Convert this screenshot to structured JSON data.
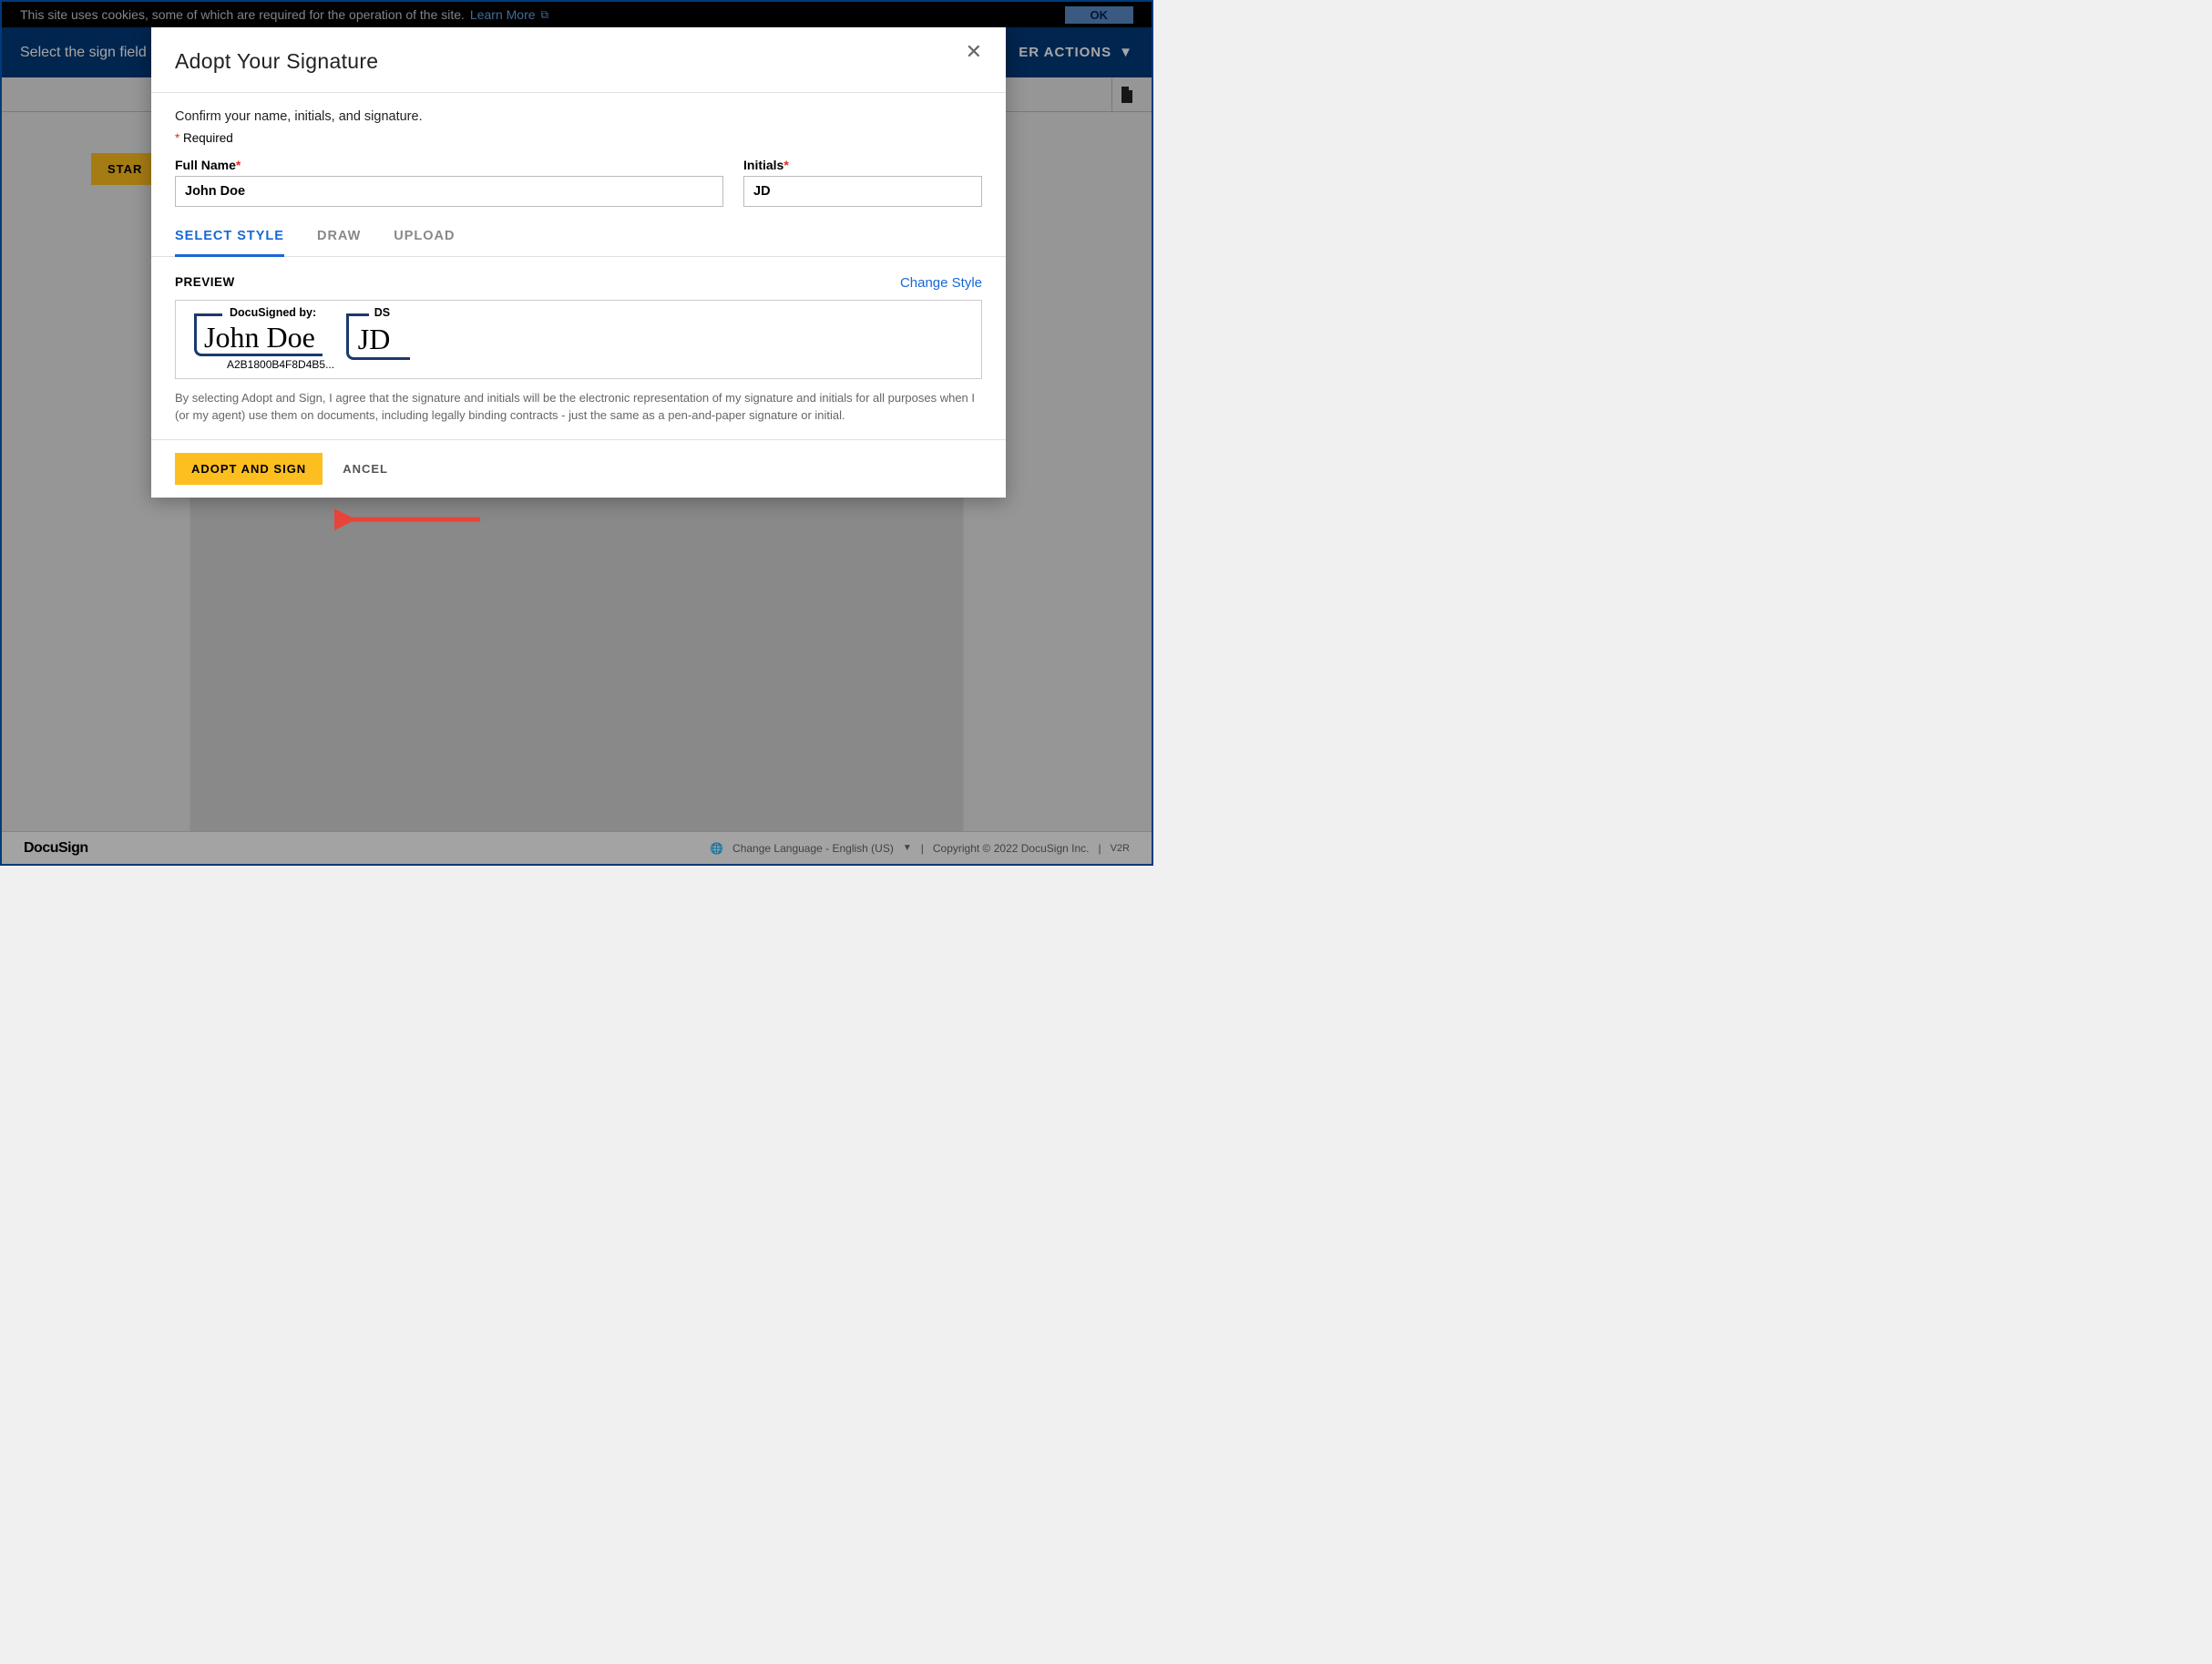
{
  "cookie": {
    "text": "This site uses cookies, some of which are required for the operation of the site.",
    "learn_more": "Learn More",
    "ok": "OK"
  },
  "header": {
    "left_text": "Select the sign field",
    "actions_label": "ER ACTIONS"
  },
  "start_label": "STAR",
  "modal": {
    "title": "Adopt Your Signature",
    "instruction": "Confirm your name, initials, and signature.",
    "required_label": "Required",
    "full_name_label": "Full Name",
    "full_name_value": "John Doe",
    "initials_label": "Initials",
    "initials_value": "JD",
    "tabs": {
      "select": "SELECT STYLE",
      "draw": "DRAW",
      "upload": "UPLOAD"
    },
    "preview_label": "PREVIEW",
    "change_style": "Change Style",
    "docusigned_by": "DocuSigned by:",
    "ds_label": "DS",
    "sig_hash": "A2B1800B4F8D4B5...",
    "disclaimer": "By selecting Adopt and Sign, I agree that the signature and initials will be the electronic representation of my signature and initials for all purposes when I (or my agent) use them on documents, including legally binding contracts - just the same as a pen-and-paper signature or initial.",
    "adopt_label": "ADOPT AND SIGN",
    "cancel_label": "ANCEL"
  },
  "footer": {
    "brand": "DocuSign",
    "lang": "Change Language - English (US)",
    "copyright": "Copyright © 2022 DocuSign Inc.",
    "v2r": "V2R"
  }
}
